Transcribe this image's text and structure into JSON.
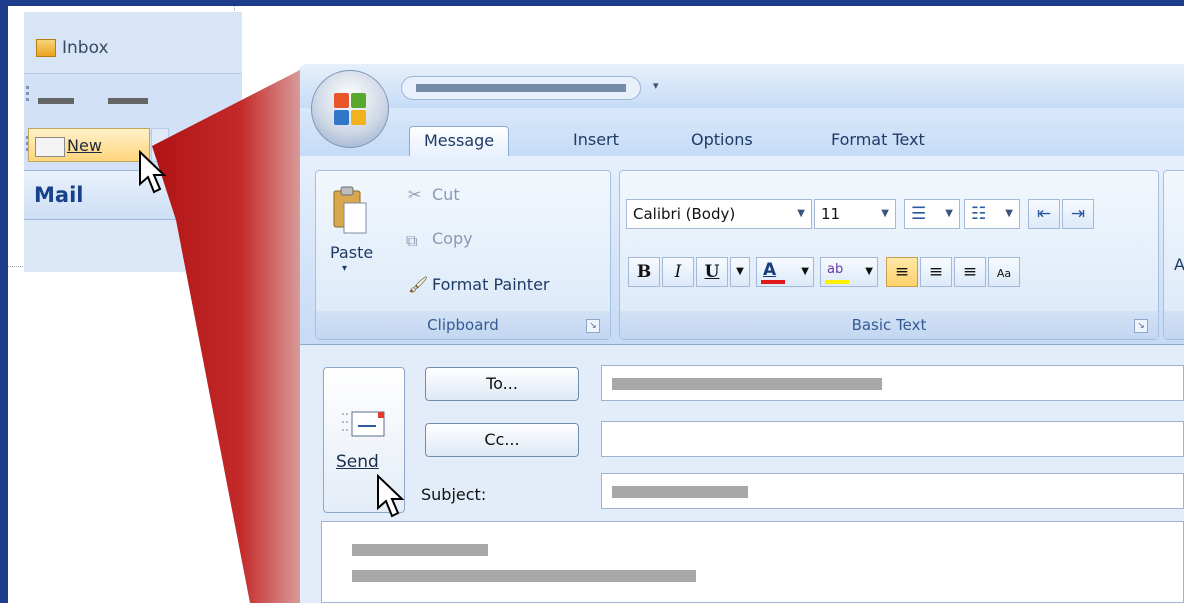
{
  "outlook_panel": {
    "inbox_label": "Inbox",
    "new_button_label": "New",
    "mail_label": "Mail"
  },
  "compose": {
    "tabs": [
      "Message",
      "Insert",
      "Options",
      "Format Text"
    ],
    "active_tab": "Message",
    "clipboard": {
      "paste_label": "Paste",
      "cut_label": "Cut",
      "copy_label": "Copy",
      "format_painter_label": "Format Painter",
      "group_label": "Clipboard"
    },
    "basic_text": {
      "font_name": "Calibri (Body)",
      "font_size": "11",
      "group_label": "Basic Text",
      "bold": "B",
      "italic": "I",
      "underline": "U",
      "font_color_letter": "A"
    },
    "next_group_partial_label": "A",
    "send_label": "Send",
    "to_label": "To...",
    "cc_label": "Cc...",
    "subject_label": "Subject:"
  },
  "colors": {
    "frame_blue": "#1d3c8c",
    "zoom_red": "#c41e1e",
    "ribbon_blue": "#bfdbff",
    "highlight_orange": "#ffd26a"
  }
}
